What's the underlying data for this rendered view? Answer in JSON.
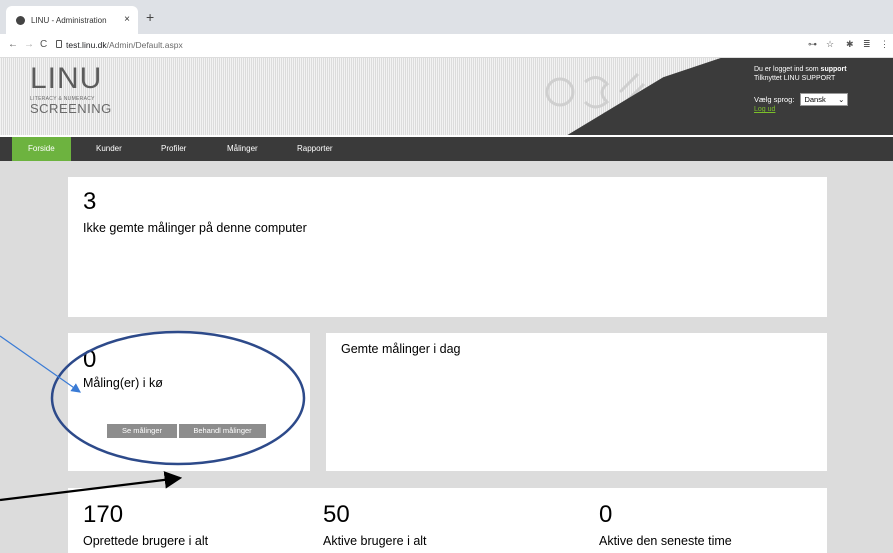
{
  "browser": {
    "tab_title": "LINU - Administration",
    "tab_close": "×",
    "new_tab": "+",
    "url_host": "test.linu.dk",
    "url_path": "/Admin/Default.aspx",
    "back": "←",
    "forward": "→",
    "reload": "C"
  },
  "header": {
    "logo_main": "LINU",
    "logo_small": "LITERACY & NUMERACY",
    "logo_screening": "SCREENING",
    "user_line_prefix": "Du er logget ind som",
    "user_name": "support",
    "affiliation": "Tilknyttet LINU SUPPORT",
    "language_label": "Vælg sprog:",
    "language_value": "Dansk",
    "logout": "Log ud"
  },
  "menu": {
    "items": [
      "Forside",
      "Kunder",
      "Profiler",
      "Målinger",
      "Rapporter"
    ]
  },
  "dashboard": {
    "unsaved_count": "3",
    "unsaved_label": "Ikke gemte målinger på denne computer",
    "queue_count": "0",
    "queue_label": "Måling(er) i kø",
    "btn_see": "Se målinger",
    "btn_process": "Behandl målinger",
    "saved_today_label": "Gemte målinger i dag",
    "created_users_count": "170",
    "created_users_label": "Oprettede brugere i alt",
    "active_users_count": "50",
    "active_users_label": "Aktive brugere i alt",
    "active_hour_count": "0",
    "active_hour_label": "Aktive den seneste time"
  },
  "colors": {
    "menu_active": "#6db33f",
    "menu_bg": "#3a3a3a",
    "annotation_blue": "#2d4a8a",
    "arrow_blue": "#3a7bd5"
  }
}
